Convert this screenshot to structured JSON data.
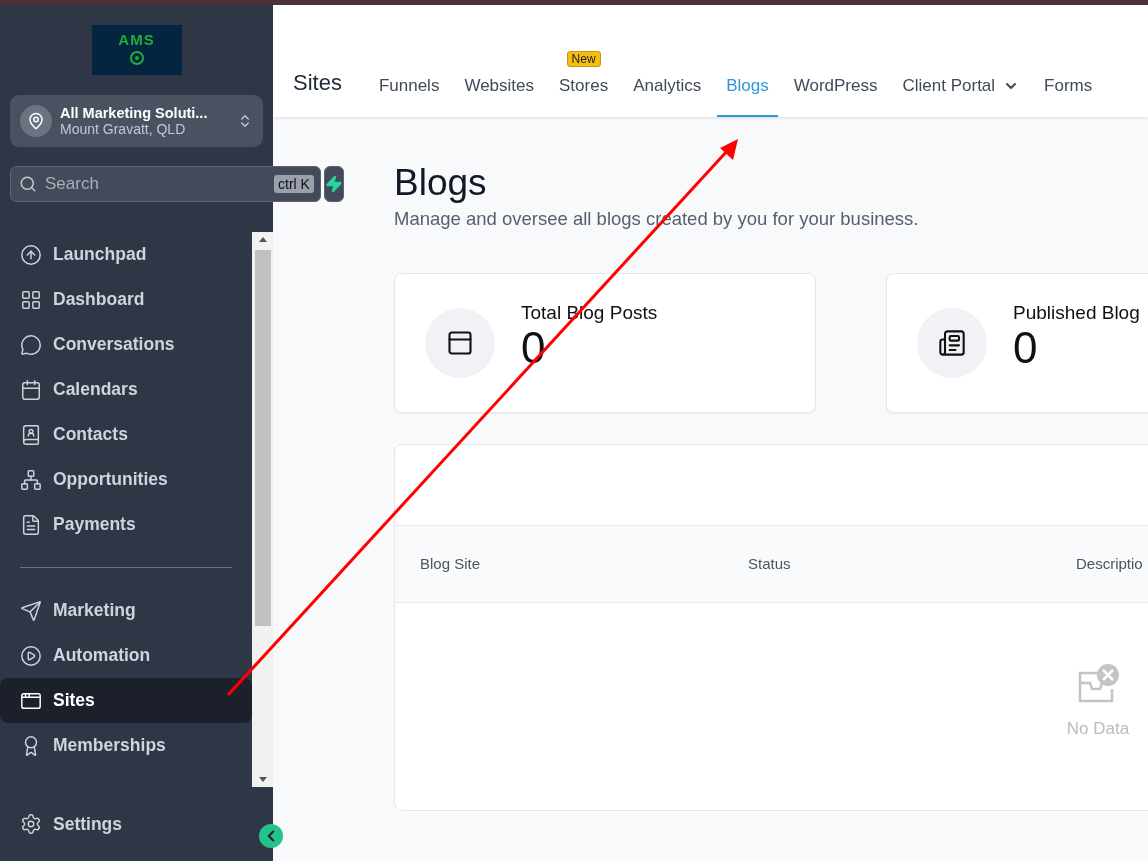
{
  "sidebar": {
    "logo": {
      "text": "AMS"
    },
    "account": {
      "name": "All Marketing Soluti...",
      "location": "Mount Gravatt, QLD"
    },
    "search": {
      "placeholder": "Search",
      "shortcut": "ctrl K"
    },
    "nav": [
      {
        "kind": "item",
        "label": "Launchpad",
        "selected": false
      },
      {
        "kind": "item",
        "label": "Dashboard",
        "selected": false
      },
      {
        "kind": "item",
        "label": "Conversations",
        "selected": false
      },
      {
        "kind": "item",
        "label": "Calendars",
        "selected": false
      },
      {
        "kind": "item",
        "label": "Contacts",
        "selected": false
      },
      {
        "kind": "item",
        "label": "Opportunities",
        "selected": false
      },
      {
        "kind": "item",
        "label": "Payments",
        "selected": false
      },
      {
        "kind": "divider"
      },
      {
        "kind": "item",
        "label": "Marketing",
        "selected": false
      },
      {
        "kind": "item",
        "label": "Automation",
        "selected": false
      },
      {
        "kind": "item",
        "label": "Sites",
        "selected": true
      },
      {
        "kind": "item",
        "label": "Memberships",
        "selected": false
      }
    ],
    "settings": "Settings"
  },
  "header": {
    "title": "Sites",
    "tabs": [
      {
        "label": "Funnels",
        "selected": false
      },
      {
        "label": "Websites",
        "selected": false
      },
      {
        "label": "Stores",
        "selected": false,
        "badge": "New"
      },
      {
        "label": "Analytics",
        "selected": false
      },
      {
        "label": "Blogs",
        "selected": true
      },
      {
        "label": "WordPress",
        "selected": false
      },
      {
        "label": "Client Portal",
        "selected": false,
        "dropdown": true
      },
      {
        "label": "Forms",
        "selected": false
      }
    ]
  },
  "page": {
    "title": "Blogs",
    "subtitle": "Manage and oversee all blogs created by you for your business.",
    "stats": [
      {
        "label": "Total Blog Posts",
        "value": "0"
      },
      {
        "label": "Published Blog",
        "value": "0"
      }
    ],
    "table": {
      "columns": [
        "Blog Site",
        "Status",
        "Descriptio"
      ],
      "empty": "No Data"
    }
  }
}
